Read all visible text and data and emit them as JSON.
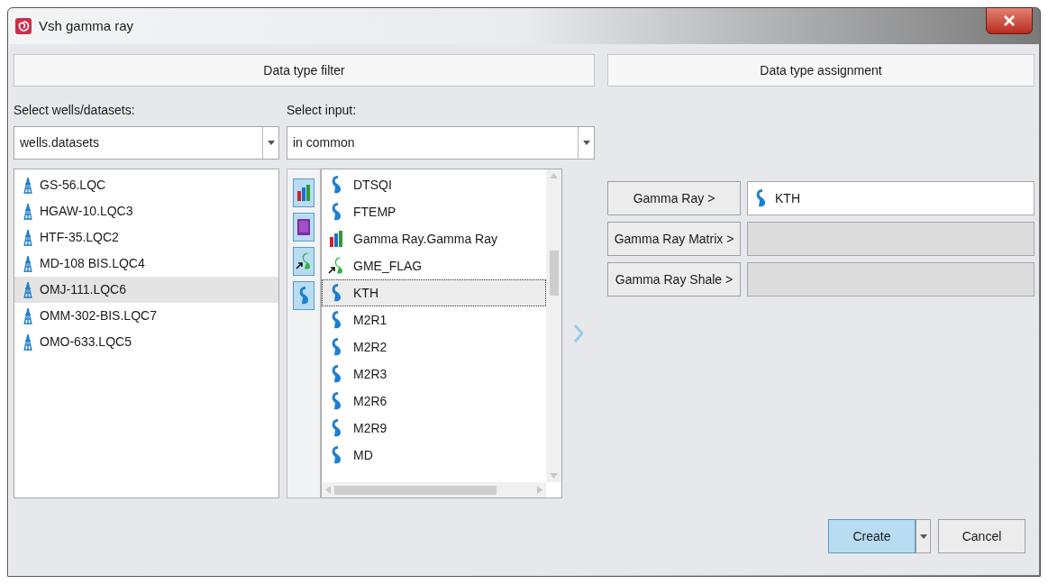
{
  "window": {
    "title": "Vsh gamma ray"
  },
  "filter": {
    "header": "Data type filter",
    "wells_label": "Select wells/datasets:",
    "wells_combo": "wells.datasets",
    "input_label": "Select input:",
    "input_combo": "in common",
    "wells": [
      {
        "name": "GS-56.LQC",
        "selected": false
      },
      {
        "name": "HGAW-10.LQC3",
        "selected": false
      },
      {
        "name": "HTF-35.LQC2",
        "selected": false
      },
      {
        "name": "MD-108 BIS.LQC4",
        "selected": false
      },
      {
        "name": "OMJ-111.LQC6",
        "selected": true
      },
      {
        "name": "OMM-302-BIS.LQC7",
        "selected": false
      },
      {
        "name": "OMO-633.LQC5",
        "selected": false
      }
    ],
    "type_filters": [
      {
        "kind": "multi",
        "on": true
      },
      {
        "kind": "book",
        "on": true
      },
      {
        "kind": "flag",
        "on": true
      },
      {
        "kind": "curve",
        "on": true
      }
    ],
    "inputs": [
      {
        "name": "DTSQI",
        "kind": "curve",
        "selected": false
      },
      {
        "name": "FTEMP",
        "kind": "curve",
        "selected": false
      },
      {
        "name": "Gamma Ray.Gamma Ray",
        "kind": "multi",
        "selected": false
      },
      {
        "name": "GME_FLAG",
        "kind": "flag",
        "selected": false
      },
      {
        "name": "KTH",
        "kind": "curve",
        "selected": true
      },
      {
        "name": "M2R1",
        "kind": "curve",
        "selected": false
      },
      {
        "name": "M2R2",
        "kind": "curve",
        "selected": false
      },
      {
        "name": "M2R3",
        "kind": "curve",
        "selected": false
      },
      {
        "name": "M2R6",
        "kind": "curve",
        "selected": false
      },
      {
        "name": "M2R9",
        "kind": "curve",
        "selected": false
      },
      {
        "name": "MD",
        "kind": "curve",
        "selected": false
      }
    ]
  },
  "assignment": {
    "header": "Data type assignment",
    "rows": [
      {
        "label": "Gamma Ray >",
        "value": "KTH",
        "kind": "curve"
      },
      {
        "label": "Gamma Ray Matrix >"
      },
      {
        "label": "Gamma Ray Shale >"
      }
    ]
  },
  "buttons": {
    "create": "Create",
    "cancel": "Cancel"
  }
}
